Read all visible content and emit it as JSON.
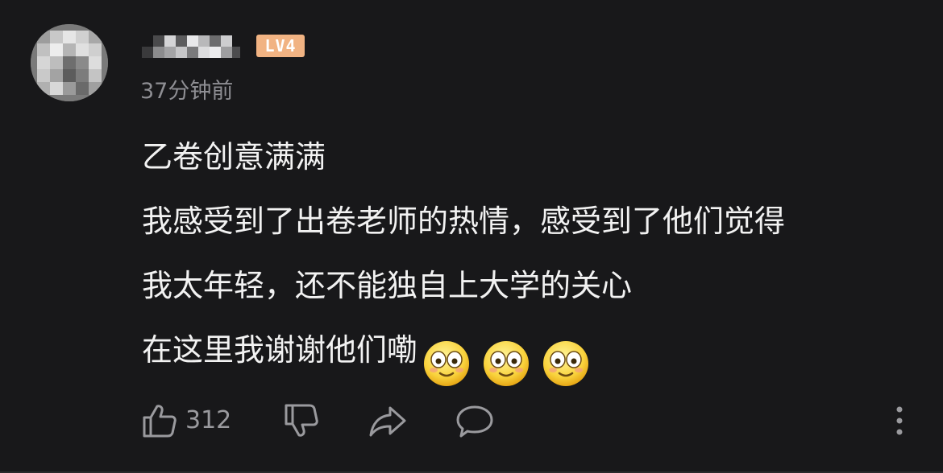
{
  "comment": {
    "author": {
      "avatar_icon": "blurred-avatar",
      "username_icon": "blurred-username",
      "level": "LV4",
      "level_badge_color": "#f1b383"
    },
    "timestamp": "37分钟前",
    "lines": [
      "乙卷创意满满",
      "我感受到了出卷老师的热情，感受到了他们觉得",
      "我太年轻，还不能独自上大学的关心",
      "在这里我谢谢他们嘞"
    ],
    "emojis": [
      "flushed-face-icon",
      "flushed-face-icon",
      "flushed-face-icon"
    ],
    "actions": {
      "like_icon": "thumbs-up-icon",
      "like_count": "312",
      "dislike_icon": "thumbs-down-icon",
      "share_icon": "share-arrow-icon",
      "reply_icon": "speech-bubble-icon",
      "more_icon": "more-vertical-icon"
    }
  },
  "colors": {
    "background": "#18181a",
    "text": "#f2f2f2",
    "secondary_text": "#8e8e93",
    "icon": "#9a9a9e"
  }
}
